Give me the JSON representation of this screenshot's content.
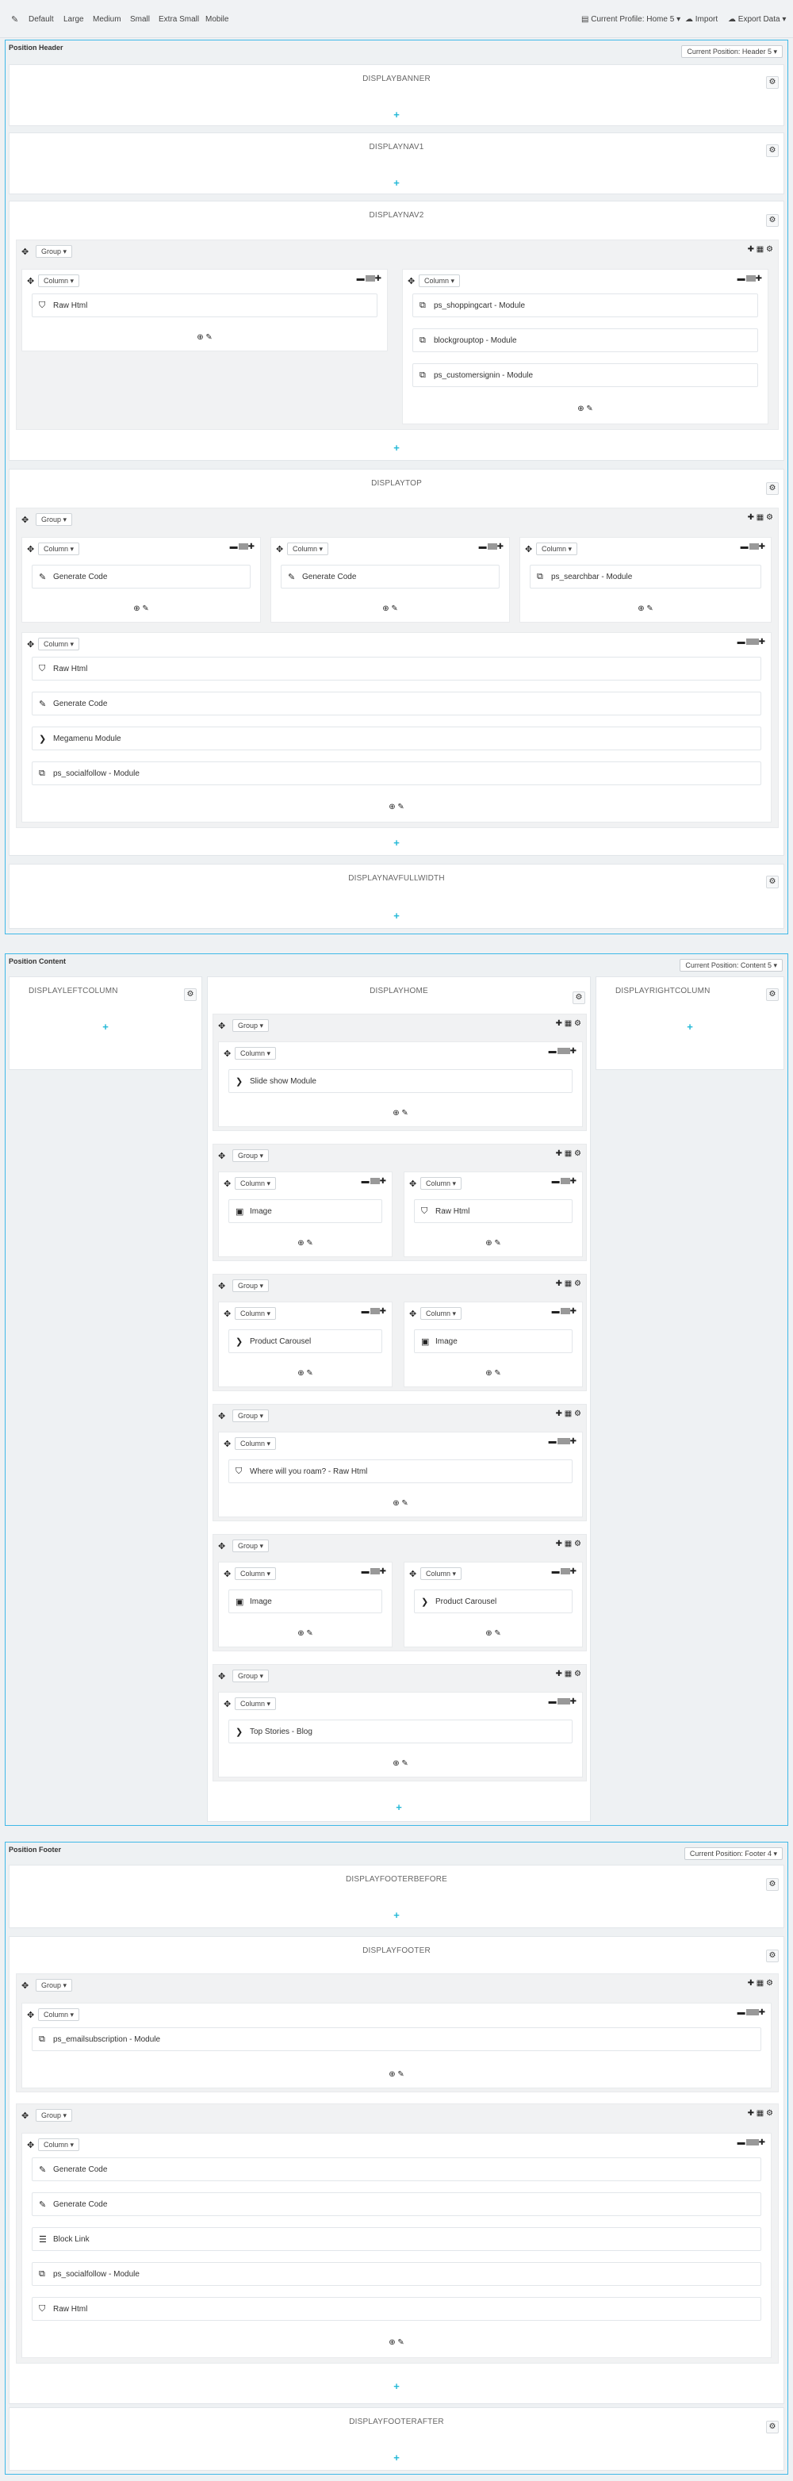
{
  "toolbar": {
    "items": [
      "Default",
      "Large",
      "Medium",
      "Small",
      "Extra Small",
      "Mobile"
    ],
    "profile": "Current Profile: Home 5",
    "import": "Import",
    "export": "Export Data"
  },
  "positions": {
    "header": {
      "title": "Position Header",
      "select": "Current Position: Header 5",
      "hooks": [
        "DISPLAYBANNER",
        "DISPLAYNAV1",
        "DISPLAYNAV2",
        "DISPLAYTOP",
        "DISPLAYNAVFULLWIDTH"
      ]
    },
    "content": {
      "title": "Position Content",
      "select": "Current Position: Content 5",
      "hooks": [
        "DISPLAYLEFTCOLUMN",
        "DISPLAYHOME",
        "DISPLAYRIGHTCOLUMN"
      ]
    },
    "footer": {
      "title": "Position Footer",
      "select": "Current Position: Footer 4",
      "hooks": [
        "DISPLAYFOOTERBEFORE",
        "DISPLAYFOOTER",
        "DISPLAYFOOTERAFTER"
      ]
    }
  },
  "labels": {
    "group": "Group",
    "column": "Column"
  },
  "modules": {
    "raw_html": "Raw Html",
    "shoppingcart": "ps_shoppingcart - Module",
    "blockgrouptop": "blockgrouptop - Module",
    "customersignin": "ps_customersignin - Module",
    "generate_code": "Generate Code",
    "searchbar": "ps_searchbar - Module",
    "megamenu": "Megamenu Module",
    "socialfollow": "ps_socialfollow - Module",
    "slideshow": "Slide show Module",
    "image": "Image",
    "product_carousel": "Product Carousel",
    "where_roam": "Where will you roam? - Raw Html",
    "top_stories": "Top Stories - Blog",
    "emailsubscription": "ps_emailsubscription - Module",
    "block_link": "Block Link"
  },
  "accent_color": "#25b9d7",
  "border_color": "#3fb9e8"
}
